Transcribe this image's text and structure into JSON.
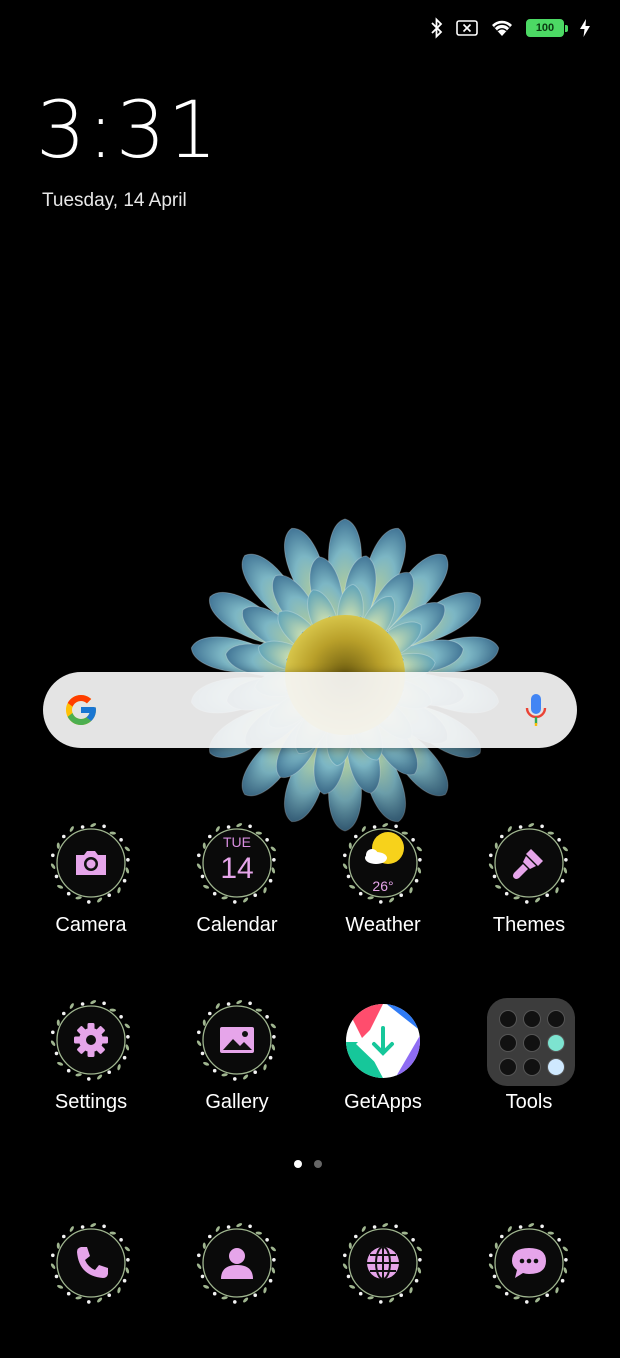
{
  "status_bar": {
    "icons": [
      "bluetooth-icon",
      "no-sim-icon",
      "wifi-icon",
      "battery-icon",
      "charging-icon"
    ],
    "battery_level": "100",
    "battery_color": "#4cd964"
  },
  "lockscreen": {
    "time": "3:31",
    "date": "Tuesday, 14 April"
  },
  "search_widget": {
    "icons": [
      "google-g-icon",
      "microphone-icon"
    ]
  },
  "apps": [
    {
      "label": "Camera",
      "icon": "camera-icon"
    },
    {
      "label": "Calendar",
      "icon": "calendar-icon",
      "day": "TUE",
      "date": "14"
    },
    {
      "label": "Weather",
      "icon": "weather-icon",
      "temperature": "26°"
    },
    {
      "label": "Themes",
      "icon": "paintbrush-icon"
    },
    {
      "label": "Settings",
      "icon": "gear-icon"
    },
    {
      "label": "Gallery",
      "icon": "image-icon"
    },
    {
      "label": "GetApps",
      "icon": "getapps-icon"
    },
    {
      "label": "Tools",
      "icon": "folder-icon"
    }
  ],
  "page_indicator": {
    "pages": 2,
    "current": 1
  },
  "dock": [
    {
      "icon": "phone-icon"
    },
    {
      "icon": "contacts-icon"
    },
    {
      "icon": "browser-globe-icon"
    },
    {
      "icon": "messages-icon"
    }
  ],
  "theme": {
    "accent": "#e6a5ea",
    "wreath": "#9fb58f"
  }
}
